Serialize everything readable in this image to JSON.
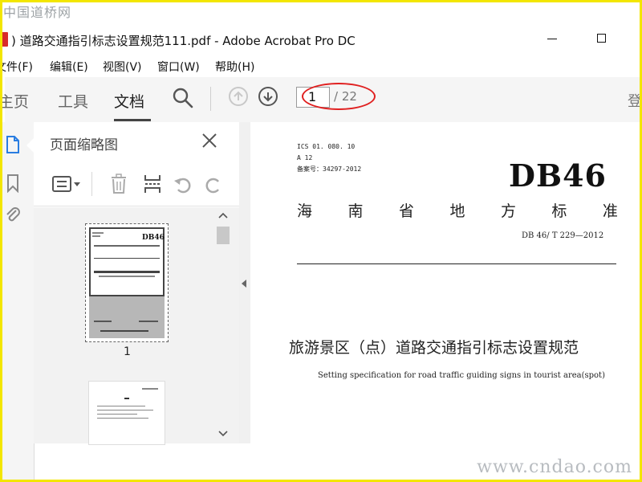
{
  "watermark": {
    "top": "中国道桥网",
    "bottom": "www.cndao.com"
  },
  "window": {
    "title": ") 道路交通指引标志设置规范111.pdf - Adobe Acrobat Pro DC"
  },
  "menu": {
    "items": [
      "文件(F)",
      "编辑(E)",
      "视图(V)",
      "窗口(W)",
      "帮助(H)"
    ]
  },
  "toolbar": {
    "tabs": [
      "主页",
      "工具",
      "文档"
    ],
    "active_tab": "文档",
    "page_current": "1",
    "page_total": "/ 22",
    "signin": "登"
  },
  "thumbnail_panel": {
    "title": "页面缩略图",
    "page_labels": [
      "1"
    ]
  },
  "document": {
    "ics": "ICS 01. 080. 10",
    "class_code": "A 12",
    "record": "备案号：34297-2012",
    "db": "DB46",
    "std_chars": [
      "海",
      "南",
      "省",
      "地",
      "方",
      "标",
      "准"
    ],
    "std_code": "DB 46/ T 229—2012",
    "title_cn": "旅游景区（点）道路交通指引标志设置规范",
    "title_en": "Setting specification for road traffic guiding signs in tourist area(spot)"
  },
  "colors": {
    "highlight_oval": "#e02020",
    "frame": "#f3e600",
    "pdf_icon": "#d82b2b"
  }
}
